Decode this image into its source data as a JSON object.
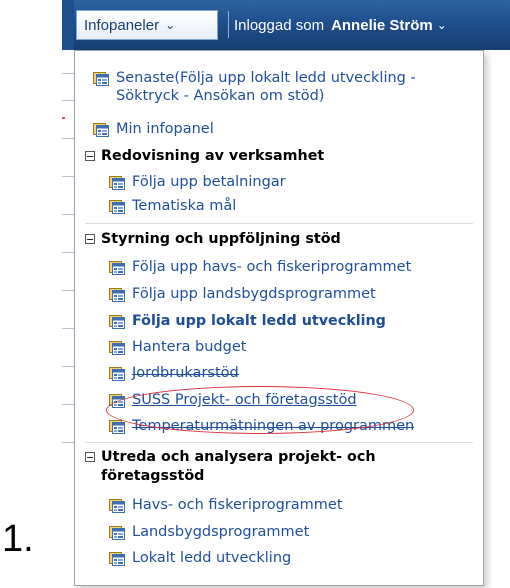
{
  "step_label": "1.",
  "topbar": {
    "menu_label": "Infopaneler",
    "logged_in_prefix": "Inloggad som",
    "user_name": "Annelie Ström"
  },
  "menu": {
    "top_items": [
      {
        "label": "Senaste(Följa upp lokalt ledd utveckling - Söktryck - Ansökan om stöd)"
      },
      {
        "label": "Min infopanel"
      }
    ],
    "groups": [
      {
        "title": "Redovisning av verksamhet",
        "items": [
          {
            "label": "Följa upp betalningar"
          },
          {
            "label": "Tematiska mål"
          }
        ]
      },
      {
        "title": "Styrning och uppföljning stöd",
        "items": [
          {
            "label": "Följa upp havs- och fiskeriprogrammet"
          },
          {
            "label": "Följa upp landsbygdsprogrammet"
          },
          {
            "label": "Följa upp lokalt ledd utveckling"
          },
          {
            "label": "Hantera budget"
          },
          {
            "label": "Jordbrukarstöd"
          },
          {
            "label": "SUSS Projekt- och företagsstöd"
          },
          {
            "label": "Temperaturmätningen av programmen"
          }
        ]
      },
      {
        "title": "Utreda och analysera projekt- och företagsstöd",
        "items": [
          {
            "label": "Havs- och fiskeriprogrammet"
          },
          {
            "label": "Landsbygdsprogrammet"
          },
          {
            "label": "Lokalt ledd utveckling"
          }
        ]
      }
    ]
  },
  "icons": {
    "panel_icon": "dashboard-icon",
    "collapse_icon": "collapse-minus-icon",
    "menu_chevron": "chevron-down-icon"
  },
  "colors": {
    "topbar": "#1f4e8c",
    "link": "#1f4f9c",
    "highlight_ellipse": "#d9313e"
  }
}
